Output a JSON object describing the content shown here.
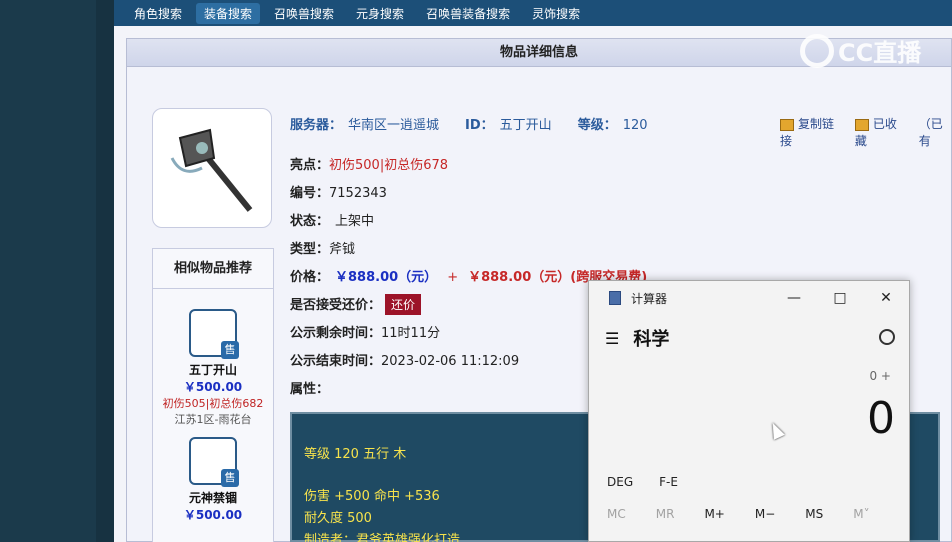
{
  "nav": {
    "tabs": [
      "角色搜索",
      "装备搜索",
      "召唤兽搜索",
      "元身搜索",
      "召唤兽装备搜索",
      "灵饰搜索"
    ],
    "active": 1
  },
  "panel": {
    "title": "物品详细信息"
  },
  "watermark": "CC直播",
  "info": {
    "server_label": "服务器：",
    "server_value": "华南区一逍遥城",
    "id_label": "ID：",
    "id_value": "五丁开山",
    "level_label": "等级：",
    "level_value": "120"
  },
  "actions": {
    "copy": "复制链接",
    "fav": "已收藏",
    "extra": "（已有"
  },
  "details": {
    "highlight_label": "亮点：",
    "highlight_value": "初伤500|初总伤678",
    "number_label": "编号：",
    "number_value": "7152343",
    "status_label": "状态：",
    "status_value": "上架中",
    "type_label": "类型：",
    "type_value": "斧钺",
    "price_label": "价格：",
    "price_value": "￥888.00（元）",
    "price_plus": "+",
    "price_cross": "￥888.00（元）(跨服交易费)",
    "counter_label": "是否接受还价：",
    "counter_button": "还价",
    "remain_label": "公示剩余时间：",
    "remain_value": "11时11分",
    "end_label": "公示结束时间：",
    "end_value": "2023-02-06 11:12:09",
    "attr_label": "属性："
  },
  "attr_box": {
    "line1": "等级 120  五行 木",
    "line2": "伤害 +500 命中 +536",
    "line3": "耐久度 500",
    "line4": "制造者：君爷英雄强化打造"
  },
  "similar": {
    "title": "相似物品推荐",
    "items": [
      {
        "name": "五丁开山",
        "price": "￥500.00",
        "attr": "初伤505|初总伤682",
        "server": "江苏1区-雨花台",
        "sale": "售"
      },
      {
        "name": "元神禁锢",
        "price": "￥500.00",
        "sale": "售"
      }
    ]
  },
  "calculator": {
    "title": "计算器",
    "mode": "科学",
    "expression": "0 +",
    "display": "0",
    "deg": "DEG",
    "fe": "F-E",
    "mem": [
      "MC",
      "MR",
      "M+",
      "M−",
      "MS",
      "M˅"
    ]
  }
}
